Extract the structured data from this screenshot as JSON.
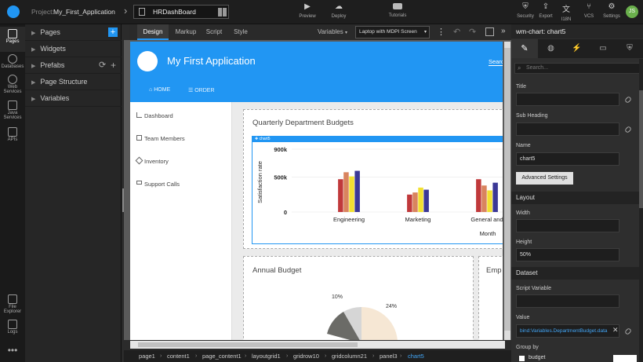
{
  "topbar": {
    "project_prefix": "Project:",
    "project_name": "My_First_Application",
    "page_name": "HRDashBoard",
    "preview_label": "Preview",
    "deploy_label": "Deploy",
    "tutorials_label": "Tutorials",
    "security_label": "Security",
    "export_label": "Export",
    "i18n_label": "I18N",
    "vcs_label": "VCS",
    "settings_label": "Settings",
    "avatar_initials": "JS"
  },
  "rail": {
    "pages": "Pages",
    "databases": "Databases",
    "web_services": "Web Services",
    "java_services": "Java Services",
    "apis": "APIs",
    "file_explorer": "File Explorer",
    "logs": "Logs"
  },
  "tree": [
    "Pages",
    "Widgets",
    "Prefabs",
    "Page Structure",
    "Variables"
  ],
  "canvas_tabs": {
    "design": "Design",
    "markup": "Markup",
    "script": "Script",
    "style": "Style",
    "variables": "Variables",
    "device": "Laptop with MDPI Screen"
  },
  "app": {
    "title": "My First Application",
    "search": "Searc",
    "nav_home": "HOME",
    "nav_order": "ORDER",
    "sidenav": [
      "Dashboard",
      "Team Members",
      "Inventory",
      "Support Calls"
    ],
    "panel1_title": "Quarterly Department Budgets",
    "chart_tag": "chart5",
    "panel2_title": "Annual Budget",
    "panel3_title": "Emp",
    "pie_label_a": "10%",
    "pie_label_b": "24%"
  },
  "chart_data": {
    "type": "bar",
    "categories": [
      "Engineering",
      "Marketing",
      "General and"
    ],
    "xlabel": "Month",
    "ylabel": "Satisfaction rate",
    "yticks": [
      "900k",
      "500k",
      "0"
    ],
    "ylim": [
      0,
      900
    ],
    "series": [
      {
        "color": "#c0393b",
        "values": [
          470,
          250,
          470
        ]
      },
      {
        "color": "#d9845f",
        "values": [
          570,
          280,
          380
        ]
      },
      {
        "color": "#f2e030",
        "values": [
          510,
          350,
          310
        ]
      },
      {
        "color": "#3b3896",
        "values": [
          590,
          320,
          420
        ]
      }
    ]
  },
  "rightpanel": {
    "header": "wm-chart: chart5",
    "search_placeholder": "Search...",
    "title_label": "Title",
    "subheading_label": "Sub Heading",
    "name_label": "Name",
    "name_value": "chart5",
    "advanced_button": "Advanced Settings",
    "layout_section": "Layout",
    "width_label": "Width",
    "height_label": "Height",
    "height_value": "50%",
    "dataset_section": "Dataset",
    "script_variable_label": "Script Variable",
    "value_label": "Value",
    "value_value": "bind:Variables.DepartmentBudget.data",
    "groupby_label": "Group by",
    "groupby_option": "budget"
  },
  "breadcrumbs": [
    "page1",
    "content1",
    "page_content1",
    "layoutgrid1",
    "gridrow10",
    "gridcolumn21",
    "panel3",
    "chart5"
  ]
}
